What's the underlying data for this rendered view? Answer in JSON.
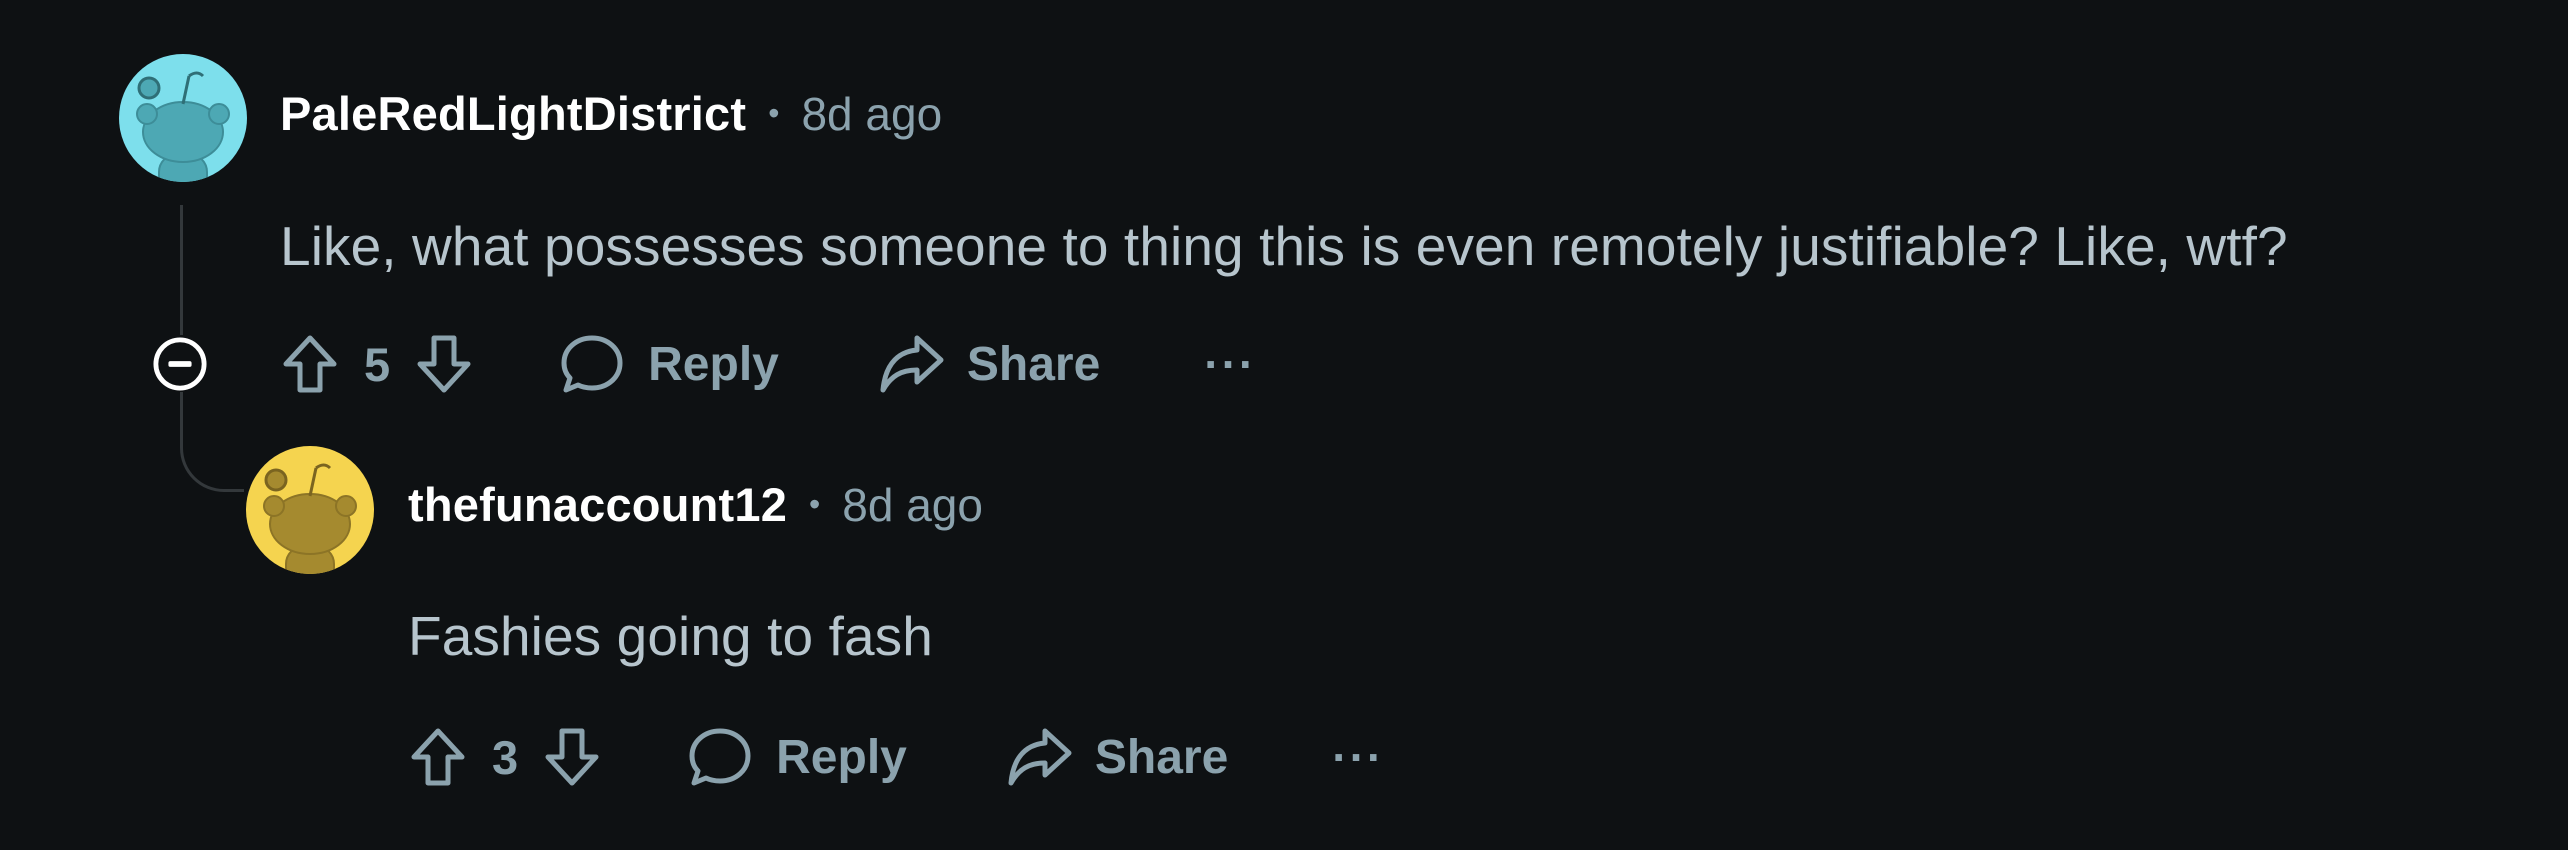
{
  "comments": [
    {
      "username": "PaleRedLightDistrict",
      "separator": "•",
      "time": "8d ago",
      "body": "Like, what possesses someone to thing this is even remotely justifiable? Like, wtf?",
      "score": "5",
      "reply_label": "Reply",
      "share_label": "Share",
      "more_label": "···",
      "avatar_color": "#7ddfec"
    },
    {
      "username": "thefunaccount12",
      "separator": "•",
      "time": "8d ago",
      "body": "Fashies going to fash",
      "score": "3",
      "reply_label": "Reply",
      "share_label": "Share",
      "more_label": "···",
      "avatar_color": "#f5d44f"
    }
  ],
  "icons": {
    "upvote": "upvote-arrow-icon",
    "downvote": "downvote-arrow-icon",
    "reply": "speech-bubble-icon",
    "share": "share-arrow-icon",
    "more": "ellipsis-icon",
    "collapse": "collapse-minus-icon",
    "avatar": "snoo-avatar-icon"
  },
  "colors": {
    "background": "#0e1113",
    "text": "#b7c5cd",
    "muted": "#8ba2ad",
    "username": "#ffffff",
    "thread_line": "#33383b"
  }
}
